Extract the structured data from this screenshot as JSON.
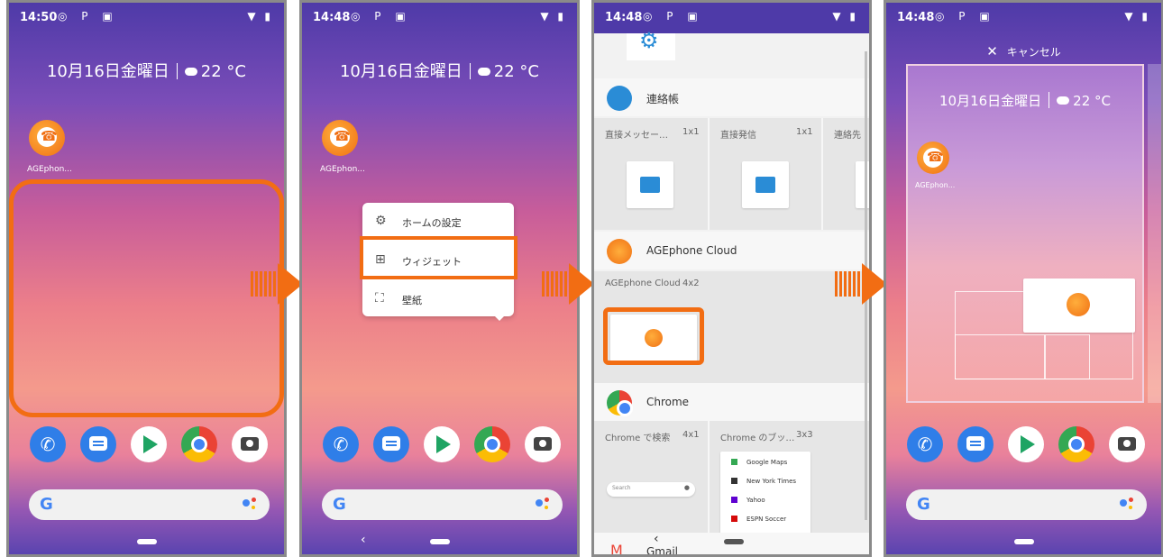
{
  "panels": [
    {
      "time": "14:50",
      "date": "10月16日金曜日",
      "temp": "22 °C",
      "app_label": "AGEphon..."
    },
    {
      "time": "14:48",
      "date": "10月16日金曜日",
      "temp": "22 °C",
      "app_label": "AGEphon...",
      "menu": [
        "ホームの設定",
        "ウィジェット",
        "壁紙"
      ]
    },
    {
      "time": "14:48",
      "contacts": {
        "title": "連絡帳",
        "w1_label": "直接メッセー…",
        "w1_size": "1x1",
        "w2_label": "直接発信",
        "w2_size": "1x1",
        "w3_label": "連絡先"
      },
      "agephone": {
        "title": "AGEphone Cloud",
        "w_label": "AGEphone Cloud",
        "w_size": "4x2"
      },
      "chrome": {
        "title": "Chrome",
        "w1_label": "Chrome で検索",
        "w1_size": "4x1",
        "w2_label": "Chrome のブッ…",
        "w2_size": "3x3",
        "search_placeholder": "Search",
        "bookmarks": [
          "Google Maps",
          "New York Times",
          "Yahoo",
          "ESPN Soccer"
        ]
      },
      "gmail": {
        "title": "Gmail"
      }
    },
    {
      "time": "14:48",
      "cancel": "キャンセル",
      "date": "10月16日金曜日",
      "temp": "22 °C",
      "app_label": "AGEphon..."
    }
  ],
  "colors": {
    "accent": "#f26d13",
    "contacts_blue": "#2a8cd6"
  }
}
